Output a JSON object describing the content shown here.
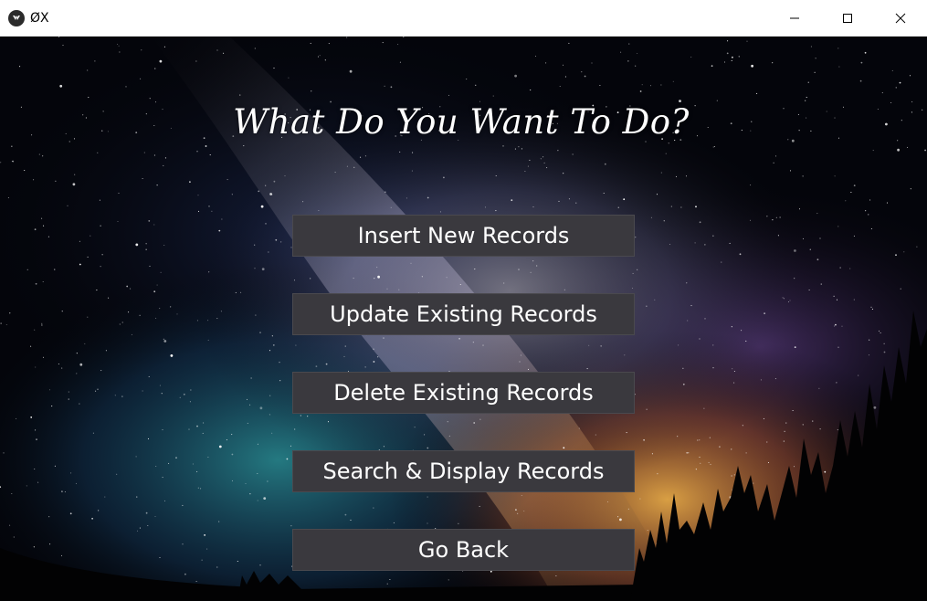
{
  "window": {
    "title": "ØX",
    "controls": {
      "minimize_icon": "minimize-icon",
      "maximize_icon": "maximize-icon",
      "close_icon": "close-icon"
    }
  },
  "main": {
    "heading": "What Do You Want To Do?",
    "buttons": [
      {
        "label": "Insert New Records"
      },
      {
        "label": "Update Existing Records"
      },
      {
        "label": "Delete Existing Records"
      },
      {
        "label": "Search & Display Records"
      },
      {
        "label": "Go Back"
      }
    ]
  },
  "colors": {
    "button_bg": "#3a393e",
    "button_text": "#ffffff",
    "titlebar_bg": "#ffffff"
  }
}
